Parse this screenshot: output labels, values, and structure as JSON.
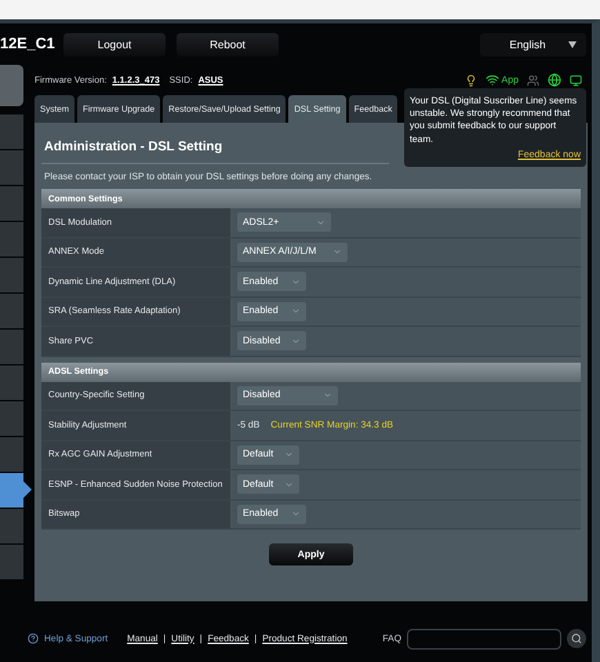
{
  "header": {
    "model": "12E_C1",
    "buttons": [
      "Logout",
      "Reboot"
    ],
    "language": "English"
  },
  "firmware": {
    "label": "Firmware Version:",
    "version": "1.1.2.3_473",
    "ssid_label": "SSID:",
    "ssid": "ASUS",
    "app_label": "App"
  },
  "sidebar": {
    "items": [
      {
        "selected": false
      },
      {
        "selected": false
      },
      {
        "selected": false
      },
      {
        "selected": false
      },
      {
        "selected": false
      },
      {
        "selected": false
      },
      {
        "selected": false
      },
      {
        "selected": false
      },
      {
        "selected": false
      },
      {
        "selected": false
      },
      {
        "selected": false
      },
      {
        "selected": true
      },
      {
        "selected": false
      },
      {
        "selected": false
      }
    ]
  },
  "tabs": [
    {
      "label": "System",
      "selected": false
    },
    {
      "label": "Firmware Upgrade",
      "selected": false
    },
    {
      "label": "Restore/Save/Upload Setting",
      "selected": false
    },
    {
      "label": "DSL Setting",
      "selected": true
    },
    {
      "label": "Feedback",
      "selected": false
    }
  ],
  "notice": {
    "text": "Your DSL (Digital Suscriber Line) seems unstable. We strongly recommend that you submit feedback to our support team.",
    "link": "Feedback now"
  },
  "title": "Administration - DSL Setting",
  "description": "Please contact your ISP to obtain your DSL settings before doing any changes.",
  "sections": [
    {
      "title": "Common Settings",
      "rows": [
        {
          "label": "DSL Modulation",
          "kind": "select",
          "value": "ADSL2+"
        },
        {
          "label": "ANNEX Mode",
          "kind": "select",
          "value": "ANNEX A/I/J/L/M"
        },
        {
          "label": "Dynamic Line Adjustment (DLA)",
          "kind": "select",
          "value": "Enabled"
        },
        {
          "label": "SRA (Seamless Rate Adaptation)",
          "kind": "select",
          "value": "Enabled"
        },
        {
          "label": "Share PVC",
          "kind": "select",
          "value": "Disabled"
        }
      ]
    },
    {
      "title": "ADSL Settings",
      "rows": [
        {
          "label": "Country-Specific Setting",
          "kind": "select",
          "value": "Disabled"
        },
        {
          "label": "Stability Adjustment",
          "kind": "reading",
          "value": "-5 dB",
          "note": "Current SNR Margin: 34.3 dB"
        },
        {
          "label": "Rx AGC GAIN Adjustment",
          "kind": "select",
          "value": "Default"
        },
        {
          "label": "ESNP - Enhanced Sudden Noise Protection",
          "kind": "select",
          "value": "Default"
        },
        {
          "label": "Bitswap",
          "kind": "select",
          "value": "Enabled"
        }
      ]
    }
  ],
  "apply": "Apply",
  "footer": {
    "help": "Help & Support",
    "links": [
      "Manual",
      "Utility",
      "Feedback",
      "Product Registration"
    ],
    "separator": "|",
    "faq": "FAQ"
  }
}
